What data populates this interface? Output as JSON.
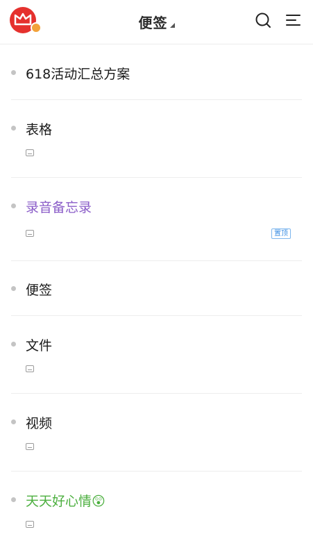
{
  "header": {
    "title": "便签"
  },
  "notes": [
    {
      "title": "618活动汇总方案",
      "color": "#1a1a1a",
      "has_attachment": false,
      "pinned": false
    },
    {
      "title": "表格",
      "color": "#1a1a1a",
      "has_attachment": true,
      "pinned": false
    },
    {
      "title": "录音备忘录",
      "color": "#8a5cc8",
      "has_attachment": true,
      "pinned": true,
      "pin_label": "置顶"
    },
    {
      "title": "便签",
      "color": "#1a1a1a",
      "has_attachment": false,
      "pinned": false
    },
    {
      "title": "文件",
      "color": "#1a1a1a",
      "has_attachment": true,
      "pinned": false
    },
    {
      "title": "视频",
      "color": "#1a1a1a",
      "has_attachment": true,
      "pinned": false
    },
    {
      "title": "天天好心情😲",
      "color": "#4caf3f",
      "has_attachment": true,
      "pinned": false
    }
  ],
  "icons": {
    "avatar": "app-logo-avatar",
    "search": "search-icon",
    "menu": "menu-icon",
    "attachment": "attachment-icon"
  }
}
